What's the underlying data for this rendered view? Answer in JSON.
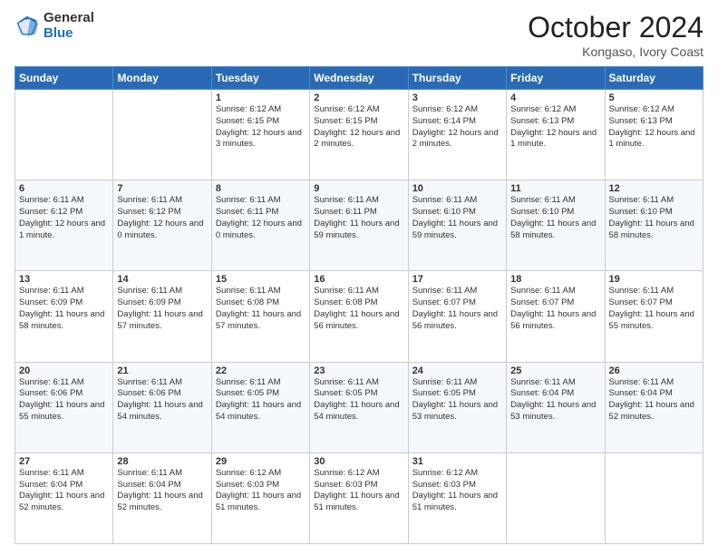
{
  "header": {
    "logo_general": "General",
    "logo_blue": "Blue",
    "month": "October 2024",
    "location": "Kongaso, Ivory Coast"
  },
  "days_of_week": [
    "Sunday",
    "Monday",
    "Tuesday",
    "Wednesday",
    "Thursday",
    "Friday",
    "Saturday"
  ],
  "weeks": [
    [
      {
        "day": "",
        "text": ""
      },
      {
        "day": "",
        "text": ""
      },
      {
        "day": "1",
        "text": "Sunrise: 6:12 AM\nSunset: 6:15 PM\nDaylight: 12 hours and 3 minutes."
      },
      {
        "day": "2",
        "text": "Sunrise: 6:12 AM\nSunset: 6:15 PM\nDaylight: 12 hours and 2 minutes."
      },
      {
        "day": "3",
        "text": "Sunrise: 6:12 AM\nSunset: 6:14 PM\nDaylight: 12 hours and 2 minutes."
      },
      {
        "day": "4",
        "text": "Sunrise: 6:12 AM\nSunset: 6:13 PM\nDaylight: 12 hours and 1 minute."
      },
      {
        "day": "5",
        "text": "Sunrise: 6:12 AM\nSunset: 6:13 PM\nDaylight: 12 hours and 1 minute."
      }
    ],
    [
      {
        "day": "6",
        "text": "Sunrise: 6:11 AM\nSunset: 6:12 PM\nDaylight: 12 hours and 1 minute."
      },
      {
        "day": "7",
        "text": "Sunrise: 6:11 AM\nSunset: 6:12 PM\nDaylight: 12 hours and 0 minutes."
      },
      {
        "day": "8",
        "text": "Sunrise: 6:11 AM\nSunset: 6:11 PM\nDaylight: 12 hours and 0 minutes."
      },
      {
        "day": "9",
        "text": "Sunrise: 6:11 AM\nSunset: 6:11 PM\nDaylight: 11 hours and 59 minutes."
      },
      {
        "day": "10",
        "text": "Sunrise: 6:11 AM\nSunset: 6:10 PM\nDaylight: 11 hours and 59 minutes."
      },
      {
        "day": "11",
        "text": "Sunrise: 6:11 AM\nSunset: 6:10 PM\nDaylight: 11 hours and 58 minutes."
      },
      {
        "day": "12",
        "text": "Sunrise: 6:11 AM\nSunset: 6:10 PM\nDaylight: 11 hours and 58 minutes."
      }
    ],
    [
      {
        "day": "13",
        "text": "Sunrise: 6:11 AM\nSunset: 6:09 PM\nDaylight: 11 hours and 58 minutes."
      },
      {
        "day": "14",
        "text": "Sunrise: 6:11 AM\nSunset: 6:09 PM\nDaylight: 11 hours and 57 minutes."
      },
      {
        "day": "15",
        "text": "Sunrise: 6:11 AM\nSunset: 6:08 PM\nDaylight: 11 hours and 57 minutes."
      },
      {
        "day": "16",
        "text": "Sunrise: 6:11 AM\nSunset: 6:08 PM\nDaylight: 11 hours and 56 minutes."
      },
      {
        "day": "17",
        "text": "Sunrise: 6:11 AM\nSunset: 6:07 PM\nDaylight: 11 hours and 56 minutes."
      },
      {
        "day": "18",
        "text": "Sunrise: 6:11 AM\nSunset: 6:07 PM\nDaylight: 11 hours and 56 minutes."
      },
      {
        "day": "19",
        "text": "Sunrise: 6:11 AM\nSunset: 6:07 PM\nDaylight: 11 hours and 55 minutes."
      }
    ],
    [
      {
        "day": "20",
        "text": "Sunrise: 6:11 AM\nSunset: 6:06 PM\nDaylight: 11 hours and 55 minutes."
      },
      {
        "day": "21",
        "text": "Sunrise: 6:11 AM\nSunset: 6:06 PM\nDaylight: 11 hours and 54 minutes."
      },
      {
        "day": "22",
        "text": "Sunrise: 6:11 AM\nSunset: 6:05 PM\nDaylight: 11 hours and 54 minutes."
      },
      {
        "day": "23",
        "text": "Sunrise: 6:11 AM\nSunset: 6:05 PM\nDaylight: 11 hours and 54 minutes."
      },
      {
        "day": "24",
        "text": "Sunrise: 6:11 AM\nSunset: 6:05 PM\nDaylight: 11 hours and 53 minutes."
      },
      {
        "day": "25",
        "text": "Sunrise: 6:11 AM\nSunset: 6:04 PM\nDaylight: 11 hours and 53 minutes."
      },
      {
        "day": "26",
        "text": "Sunrise: 6:11 AM\nSunset: 6:04 PM\nDaylight: 11 hours and 52 minutes."
      }
    ],
    [
      {
        "day": "27",
        "text": "Sunrise: 6:11 AM\nSunset: 6:04 PM\nDaylight: 11 hours and 52 minutes."
      },
      {
        "day": "28",
        "text": "Sunrise: 6:11 AM\nSunset: 6:04 PM\nDaylight: 11 hours and 52 minutes."
      },
      {
        "day": "29",
        "text": "Sunrise: 6:12 AM\nSunset: 6:03 PM\nDaylight: 11 hours and 51 minutes."
      },
      {
        "day": "30",
        "text": "Sunrise: 6:12 AM\nSunset: 6:03 PM\nDaylight: 11 hours and 51 minutes."
      },
      {
        "day": "31",
        "text": "Sunrise: 6:12 AM\nSunset: 6:03 PM\nDaylight: 11 hours and 51 minutes."
      },
      {
        "day": "",
        "text": ""
      },
      {
        "day": "",
        "text": ""
      }
    ]
  ]
}
